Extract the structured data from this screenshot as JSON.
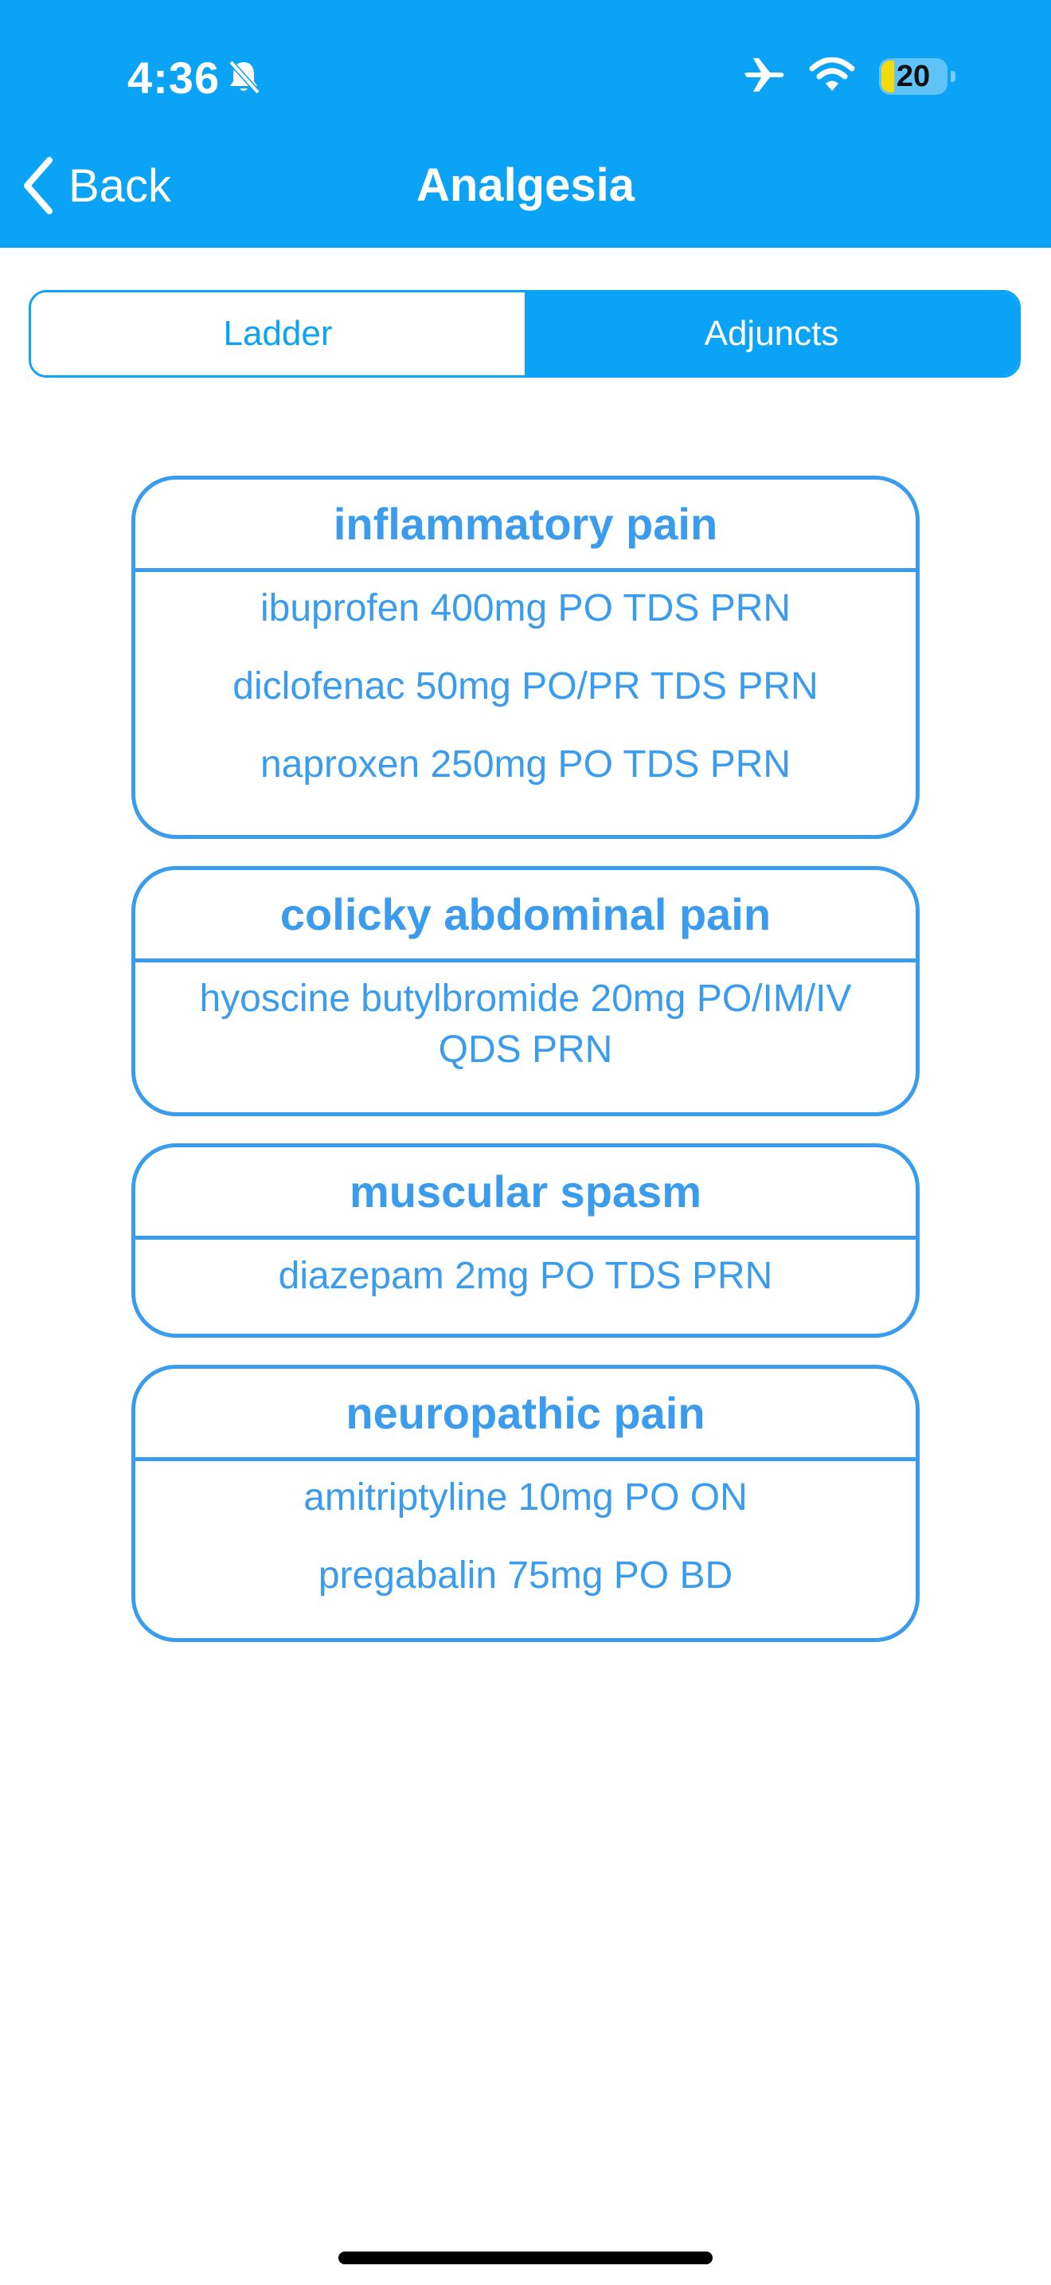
{
  "status_bar": {
    "time": "4:36",
    "battery_level": "20",
    "battery_fraction": 0.2,
    "icons": [
      "bell-slash-icon",
      "airplane-icon",
      "wifi-icon",
      "battery-icon"
    ]
  },
  "nav": {
    "back_label": "Back",
    "title": "Analgesia"
  },
  "segments": [
    {
      "label": "Ladder",
      "selected": false
    },
    {
      "label": "Adjuncts",
      "selected": true
    }
  ],
  "cards": [
    {
      "title": "inflammatory pain",
      "items": [
        "ibuprofen 400mg PO TDS PRN",
        "diclofenac 50mg PO/PR TDS PRN",
        "naproxen 250mg PO TDS PRN"
      ]
    },
    {
      "title": "colicky abdominal pain",
      "items": [
        "hyoscine butylbromide 20mg PO/IM/IV QDS PRN"
      ]
    },
    {
      "title": "muscular spasm",
      "items": [
        "diazepam 2mg PO TDS PRN"
      ]
    },
    {
      "title": "neuropathic pain",
      "items": [
        "amitriptyline 10mg PO ON",
        "pregabalin 75mg PO BD"
      ]
    }
  ],
  "colors": {
    "header": "#0aa3f5",
    "card_accent": "#3b9ced",
    "battery_fill": "#f5d90b"
  }
}
